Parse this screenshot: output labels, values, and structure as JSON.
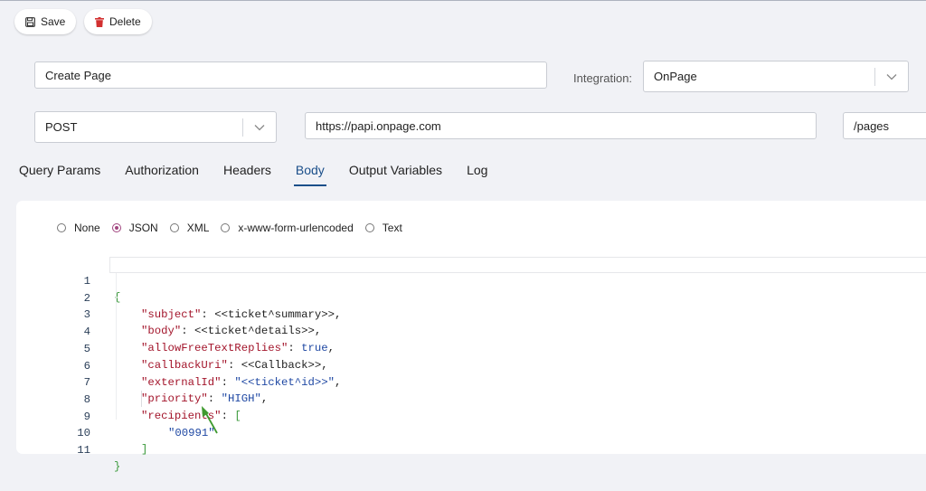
{
  "toolbar": {
    "save_label": "Save",
    "delete_label": "Delete"
  },
  "form": {
    "name_value": "Create Page",
    "integration_label": "Integration:",
    "integration_value": "OnPage",
    "method_value": "POST",
    "base_url_value": "https://papi.onpage.com",
    "path_value": "/pages"
  },
  "tabs": [
    {
      "label": "Query Params"
    },
    {
      "label": "Authorization"
    },
    {
      "label": "Headers"
    },
    {
      "label": "Body"
    },
    {
      "label": "Output Variables"
    },
    {
      "label": "Log"
    }
  ],
  "active_tab": "Body",
  "body_types": [
    {
      "label": "None"
    },
    {
      "label": "JSON"
    },
    {
      "label": "XML"
    },
    {
      "label": "x-www-form-urlencoded"
    },
    {
      "label": "Text"
    }
  ],
  "selected_body_type": "JSON",
  "code": {
    "line_numbers": [
      "1",
      "2",
      "3",
      "4",
      "5",
      "6",
      "7",
      "8",
      "9",
      "10",
      "11"
    ],
    "l1": "{",
    "l2_key": "\"subject\"",
    "l2_val": "<<ticket^summary>>,",
    "l3_key": "\"body\"",
    "l3_val": "<<ticket^details>>,",
    "l4_key": "\"allowFreeTextReplies\"",
    "l4_val": "true",
    "l5_key": "\"callbackUri\"",
    "l5_val": "<<Callback>>,",
    "l6_key": "\"externalId\"",
    "l6_val": "\"<<ticket^id>>\"",
    "l7_key": "\"priority\"",
    "l7_val": "\"HIGH\"",
    "l8_key": "\"recipients\"",
    "l8_val": "[",
    "l9_val": "\"00991\"",
    "l10": "]",
    "l11": "}"
  },
  "colors": {
    "accent": "#1b4f8a",
    "radio_selected": "#a1457f",
    "json_key": "#a3152b",
    "json_value": "#1f48a3",
    "annotation_arrow": "#3f9a2f"
  }
}
